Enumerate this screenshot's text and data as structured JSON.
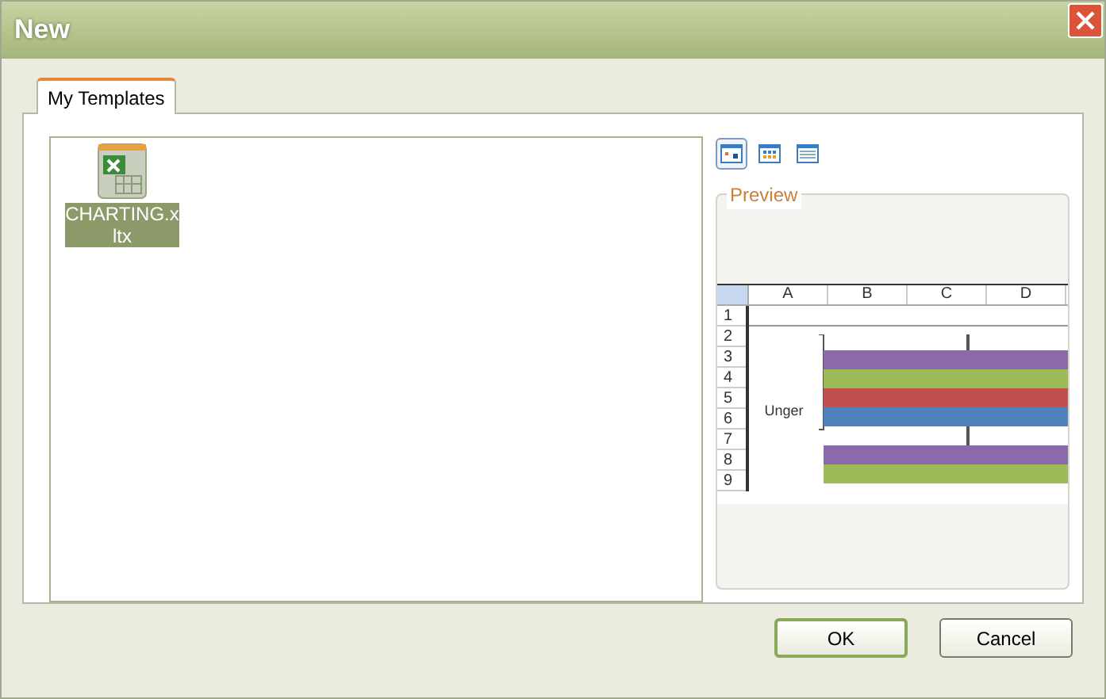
{
  "window": {
    "title": "New"
  },
  "tabs": [
    {
      "label": "My Templates",
      "selected": true
    }
  ],
  "templates": [
    {
      "name": "CHARTING.xltx",
      "selected": true
    }
  ],
  "view_buttons": [
    {
      "kind": "large",
      "selected": true
    },
    {
      "kind": "list",
      "selected": false
    },
    {
      "kind": "details",
      "selected": false
    }
  ],
  "preview": {
    "label": "Preview",
    "columns": [
      "A",
      "B",
      "C",
      "D"
    ],
    "rows": [
      "1",
      "2",
      "3",
      "4",
      "5",
      "6",
      "7",
      "8",
      "9"
    ],
    "chart_label": "Unger"
  },
  "buttons": [
    {
      "label": "OK",
      "default": true
    },
    {
      "label": "Cancel",
      "default": false
    }
  ]
}
